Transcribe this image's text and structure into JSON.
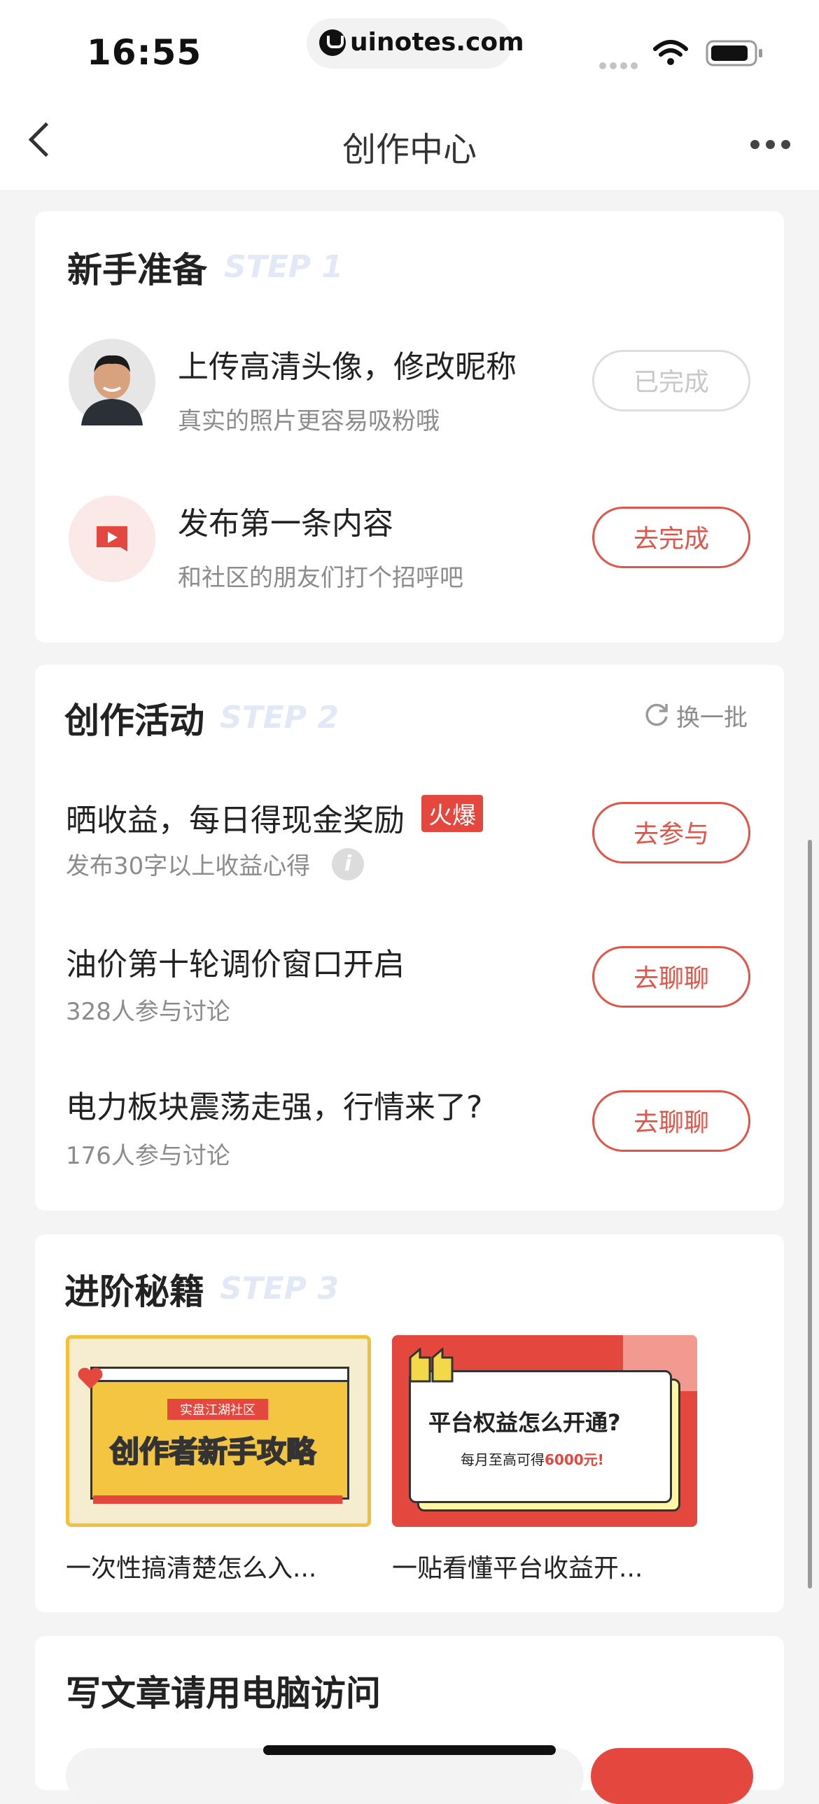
{
  "status_bar": {
    "time": "16:55",
    "url": "uinotes.com"
  },
  "nav": {
    "title": "创作中心"
  },
  "step1": {
    "title": "新手准备",
    "step": "STEP 1",
    "items": [
      {
        "title": "上传高清头像，修改昵称",
        "subtitle": "真实的照片更容易吸粉哦",
        "button": "已完成"
      },
      {
        "title": "发布第一条内容",
        "subtitle": "和社区的朋友们打个招呼吧",
        "button": "去完成"
      }
    ]
  },
  "step2": {
    "title": "创作活动",
    "step": "STEP 2",
    "refresh": "换一批",
    "items": [
      {
        "title": "晒收益，每日得现金奖励",
        "badge": "火爆",
        "subtitle": "发布30字以上收益心得",
        "button": "去参与"
      },
      {
        "title": "油价第十轮调价窗口开启",
        "subtitle": "328人参与讨论",
        "button": "去聊聊"
      },
      {
        "title": "电力板块震荡走强，行情来了?",
        "subtitle": "176人参与讨论",
        "button": "去聊聊"
      }
    ]
  },
  "step3": {
    "title": "进阶秘籍",
    "step": "STEP 3",
    "items": [
      {
        "caption": "一次性搞清楚怎么入...",
        "banner_tag": "实盘江湖社区",
        "banner_title": "创作者新手攻略"
      },
      {
        "caption": "一贴看懂平台收益开...",
        "banner_title": "平台权益怎么开通?",
        "banner_sub": "每月至高可得",
        "banner_amount": "6000元!"
      }
    ]
  },
  "step4": {
    "title": "写文章请用电脑访问"
  },
  "colors": {
    "accent": "#e0554a",
    "hot": "#e4473d",
    "step": "#e3e8f7"
  }
}
